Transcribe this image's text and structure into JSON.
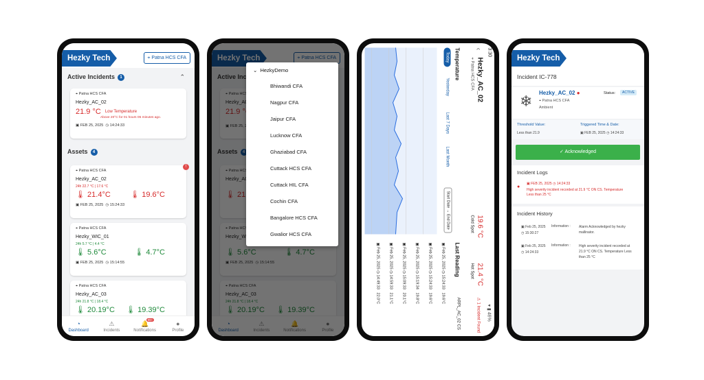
{
  "brand": "Hezky Tech",
  "location": "Patna HCS CFA",
  "nav": [
    "Dashboard",
    "Incidents",
    "Notifications",
    "Profile"
  ],
  "notif_badge": "99+",
  "active_incidents": {
    "title": "Active Incidents",
    "count": "1",
    "card": {
      "loc": "Patna HCS CFA",
      "name": "Hezky_AC_02",
      "temp": "21.9 °C",
      "type": "Low Temperature",
      "msg": "Above 20°C for 01 hours 05 minutes ago.",
      "date": "FEB 25, 2025",
      "time": "14:24:33"
    }
  },
  "assets": {
    "title": "Assets",
    "count": "4",
    "items": [
      {
        "loc": "Patna HCS CFA",
        "name": "Hezky_AC_02",
        "range": "24h  22.7 °C | 17.6 °C",
        "t1": "21.4°C",
        "t2": "19.6°C",
        "date": "FEB 25, 2025",
        "time": "15:24:33",
        "badge": "!"
      },
      {
        "loc": "Patna HCS CFA",
        "name": "Hezky_WIC_01",
        "range": "24h  5.7 °C | 4.4 °C",
        "t1": "5.6°C",
        "t2": "4.7°C",
        "date": "FEB 25, 2025",
        "time": "15:14:55"
      },
      {
        "loc": "Patna HCS CFA",
        "name": "Hezky_AC_03",
        "range": "24h  21.8 °C | 18.4 °C",
        "t1": "20.19°C",
        "t2": "19.39°C"
      }
    ]
  },
  "dropdown": {
    "header": "HezkyDemo",
    "options": [
      "Bhiwandi CFA",
      "Nagpur CFA",
      "Jaipur CFA",
      "Lucknow CFA",
      "Ghaziabad CFA",
      "Cuttack HCS CFA",
      "Cuttack HIL CFA",
      "Cochin CFA",
      "Bangalore HCS CFA",
      "Gwalior HCS CFA"
    ]
  },
  "rotated": {
    "status_time": "3:30",
    "device": "Hezky_AC_02",
    "loc": "Patna HCS CFA",
    "section": "Temperature",
    "tabs": [
      "Today",
      "Yesterday",
      "Last 7 Days",
      "Last Month"
    ],
    "yticks": [
      "15°C",
      "20°C",
      "25°C",
      "30°C"
    ],
    "date_range": "Start Date → End Date",
    "cold_label": "Cold Spot",
    "cold_val": "19.6 °C",
    "hot_label": "Hot Spot",
    "hot_val": "21.4 °C",
    "last_reading": "Last Reading",
    "incident": "1 Incident Found",
    "asset_id": "ARPL_AC_02 CS",
    "readings": [
      {
        "date": "Feb 25, 2025",
        "time": "15:24:33",
        "val": "19.6°C"
      },
      {
        "date": "Feb 25, 2025",
        "time": "15:24:33",
        "val": "19.6°C"
      },
      {
        "date": "Feb 25, 2025",
        "time": "15:19:34",
        "val": "19.8°C"
      },
      {
        "date": "Feb 25, 2025",
        "time": "15:09:33",
        "val": "20.1°C"
      },
      {
        "date": "Feb 25, 2025",
        "time": "14:59:33",
        "val": "21.1°C"
      },
      {
        "date": "Feb 25, 2025",
        "time": "14:49:33",
        "val": "22.0°C"
      }
    ]
  },
  "incident": {
    "title": "Incident IC-778",
    "device": "Hezky_AC_02",
    "loc": "Patna HCS CFA",
    "type": "Ambient",
    "status_label": "Status:",
    "status": "ACTIVE",
    "threshold_label": "Threshold Value:",
    "threshold": "Less than 21.9",
    "triggered_label": "Triggered Time & Date:",
    "trig_date": "FEB 25, 2025",
    "trig_time": "14:24:33",
    "ack": "Acknowledged",
    "logs_title": "Incident Logs",
    "log_date": "FEB 25, 2025",
    "log_time": "14:24:33",
    "log_msg": "High severity incident recorded at 21.9 °C ON CS. Temperature Less than 25 °C",
    "history_title": "Incident History",
    "history": [
      {
        "date": "Feb 25, 2025",
        "time": "15:30:27",
        "label": "Information :",
        "msg": "Alarm Acknowledged by hezky mallinator."
      },
      {
        "date": "Feb 25, 2025",
        "time": "14:24:33",
        "label": "Information :",
        "msg": "High severity incident recorded at 21.9 °C ON CS. Temperature Less than 25 °C"
      }
    ]
  }
}
